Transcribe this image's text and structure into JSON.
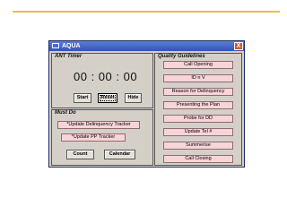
{
  "window": {
    "title": "AQUA",
    "close_glyph": "X",
    "title_icon": "folder-icon"
  },
  "ant_timer": {
    "heading": "ANT Timer",
    "display": "00 : 00 : 00",
    "buttons": [
      "Start",
      "Reset",
      "Hide"
    ]
  },
  "must_do": {
    "heading": "Must Do",
    "tasks": [
      "*Update Delinquency Tracker",
      "*Update PP Tracker"
    ],
    "buttons": [
      "Count",
      "Calendar"
    ]
  },
  "quality_guidelines": {
    "heading": "Quality Guidelines",
    "items": [
      "Call Opening",
      "ID n V",
      "Reason for Delinquency",
      "Presenting the Plan",
      "Probe for DD",
      "Update Tel #",
      "Summerise",
      "Call Closing"
    ]
  },
  "colors": {
    "accent_line": "#e2c24a",
    "title_bar": "#2f55b8",
    "pink_button": "#f7d4d8",
    "window_bg": "#d4d0c8"
  }
}
